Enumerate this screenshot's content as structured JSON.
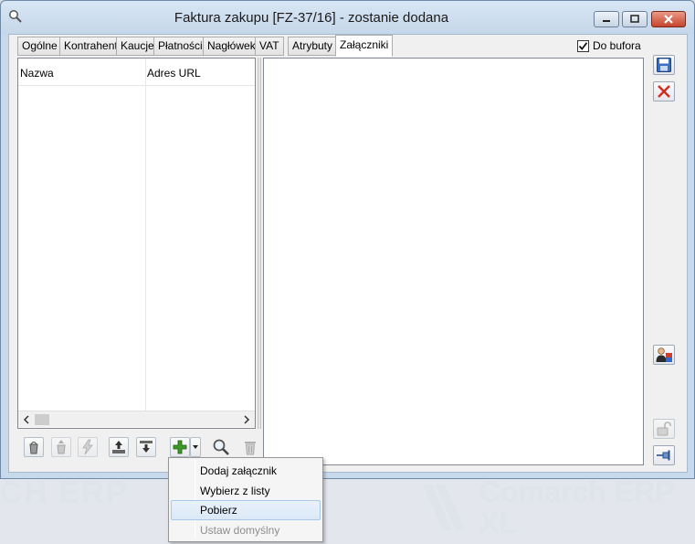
{
  "window": {
    "title": "Faktura zakupu [FZ-37/16]  - zostanie dodana"
  },
  "tabs": [
    {
      "label": "Ogólne"
    },
    {
      "label": "Kontrahent"
    },
    {
      "label": "Kaucje"
    },
    {
      "label": "Płatności"
    },
    {
      "label": "Nagłówek"
    },
    {
      "label": "VAT"
    },
    {
      "label": "Atrybuty"
    },
    {
      "label": "Załączniki",
      "active": true
    }
  ],
  "do_bufora": {
    "label": "Do bufora",
    "checked": true
  },
  "list": {
    "columns": [
      "Nazwa",
      "Adres URL"
    ]
  },
  "menu": {
    "items": [
      {
        "label": "Dodaj załącznik",
        "state": "normal"
      },
      {
        "label": "Wybierz z listy",
        "state": "normal"
      },
      {
        "label": "Pobierz",
        "state": "hover"
      },
      {
        "label": "Ustaw domyślny",
        "state": "disabled"
      }
    ]
  },
  "background": {
    "brand_left": "CH ERP",
    "brand_right": "Comarch ERP",
    "brand_right_suffix": "XL"
  },
  "colors": {
    "title_bg": "#c5d7ea",
    "close_red": "#c7442b",
    "add_green": "#3a9a22",
    "menu_hover": "#dae8f7"
  }
}
